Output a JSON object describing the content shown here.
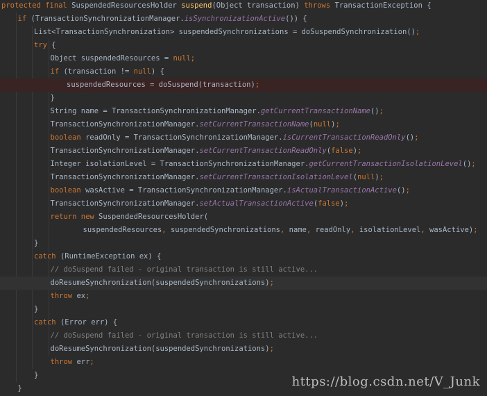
{
  "editor": {
    "theme_colors": {
      "background": "#2b2b2b",
      "keyword": "#cc7832",
      "method_declaration": "#ffc66d",
      "static_call": "#9876aa",
      "comment": "#808080",
      "default_text": "#a9b7c6",
      "breakpoint_line": "#3a2323",
      "caret_line": "#323232"
    },
    "lines": [
      {
        "indent": 0,
        "hl": "",
        "tokens": [
          {
            "t": "kw",
            "s": "protected final "
          },
          {
            "t": "df",
            "s": "SuspendedResourcesHolder "
          },
          {
            "t": "fn",
            "s": "suspend"
          },
          {
            "t": "df",
            "s": "(Object transaction) "
          },
          {
            "t": "kw",
            "s": "throws "
          },
          {
            "t": "df",
            "s": "TransactionException {"
          }
        ]
      },
      {
        "indent": 1,
        "hl": "",
        "tokens": [
          {
            "t": "kw",
            "s": "if "
          },
          {
            "t": "df",
            "s": "(TransactionSynchronizationManager."
          },
          {
            "t": "st",
            "s": "isSynchronizationActive"
          },
          {
            "t": "df",
            "s": "()) {"
          }
        ]
      },
      {
        "indent": 2,
        "hl": "",
        "tokens": [
          {
            "t": "df",
            "s": "List<TransactionSynchronization> suspendedSynchronizations = doSuspendSynchronization()"
          },
          {
            "t": "kw",
            "s": ";"
          }
        ]
      },
      {
        "indent": 2,
        "hl": "",
        "tokens": [
          {
            "t": "kw",
            "s": "try "
          },
          {
            "t": "df",
            "s": "{"
          }
        ]
      },
      {
        "indent": 3,
        "hl": "",
        "tokens": [
          {
            "t": "df",
            "s": "Object suspendedResources = "
          },
          {
            "t": "kw",
            "s": "null;"
          }
        ]
      },
      {
        "indent": 3,
        "hl": "",
        "tokens": [
          {
            "t": "kw",
            "s": "if "
          },
          {
            "t": "df",
            "s": "(transaction != "
          },
          {
            "t": "kw",
            "s": "null"
          },
          {
            "t": "df",
            "s": ") {"
          }
        ]
      },
      {
        "indent": 4,
        "hl": "breakpoint",
        "tokens": [
          {
            "t": "df",
            "s": "suspendedResources = doSuspend(transaction)"
          },
          {
            "t": "kw",
            "s": ";"
          }
        ]
      },
      {
        "indent": 3,
        "hl": "",
        "tokens": [
          {
            "t": "df",
            "s": "}"
          }
        ]
      },
      {
        "indent": 3,
        "hl": "",
        "tokens": [
          {
            "t": "df",
            "s": "String name = TransactionSynchronizationManager."
          },
          {
            "t": "st",
            "s": "getCurrentTransactionName"
          },
          {
            "t": "df",
            "s": "()"
          },
          {
            "t": "kw",
            "s": ";"
          }
        ]
      },
      {
        "indent": 3,
        "hl": "",
        "tokens": [
          {
            "t": "df",
            "s": "TransactionSynchronizationManager."
          },
          {
            "t": "st",
            "s": "setCurrentTransactionName"
          },
          {
            "t": "df",
            "s": "("
          },
          {
            "t": "kw",
            "s": "null"
          },
          {
            "t": "df",
            "s": ")"
          },
          {
            "t": "kw",
            "s": ";"
          }
        ]
      },
      {
        "indent": 3,
        "hl": "",
        "tokens": [
          {
            "t": "kw",
            "s": "boolean "
          },
          {
            "t": "df",
            "s": "readOnly = TransactionSynchronizationManager."
          },
          {
            "t": "st",
            "s": "isCurrentTransactionReadOnly"
          },
          {
            "t": "df",
            "s": "()"
          },
          {
            "t": "kw",
            "s": ";"
          }
        ]
      },
      {
        "indent": 3,
        "hl": "",
        "tokens": [
          {
            "t": "df",
            "s": "TransactionSynchronizationManager."
          },
          {
            "t": "st",
            "s": "setCurrentTransactionReadOnly"
          },
          {
            "t": "df",
            "s": "("
          },
          {
            "t": "kw",
            "s": "false"
          },
          {
            "t": "df",
            "s": ")"
          },
          {
            "t": "kw",
            "s": ";"
          }
        ]
      },
      {
        "indent": 3,
        "hl": "",
        "tokens": [
          {
            "t": "df",
            "s": "Integer isolationLevel = TransactionSynchronizationManager."
          },
          {
            "t": "st",
            "s": "getCurrentTransactionIsolationLevel"
          },
          {
            "t": "df",
            "s": "()"
          },
          {
            "t": "kw",
            "s": ";"
          }
        ]
      },
      {
        "indent": 3,
        "hl": "",
        "tokens": [
          {
            "t": "df",
            "s": "TransactionSynchronizationManager."
          },
          {
            "t": "st",
            "s": "setCurrentTransactionIsolationLevel"
          },
          {
            "t": "df",
            "s": "("
          },
          {
            "t": "kw",
            "s": "null"
          },
          {
            "t": "df",
            "s": ")"
          },
          {
            "t": "kw",
            "s": ";"
          }
        ]
      },
      {
        "indent": 3,
        "hl": "",
        "tokens": [
          {
            "t": "kw",
            "s": "boolean "
          },
          {
            "t": "df",
            "s": "wasActive = TransactionSynchronizationManager."
          },
          {
            "t": "st",
            "s": "isActualTransactionActive"
          },
          {
            "t": "df",
            "s": "()"
          },
          {
            "t": "kw",
            "s": ";"
          }
        ]
      },
      {
        "indent": 3,
        "hl": "",
        "tokens": [
          {
            "t": "df",
            "s": "TransactionSynchronizationManager."
          },
          {
            "t": "st",
            "s": "setActualTransactionActive"
          },
          {
            "t": "df",
            "s": "("
          },
          {
            "t": "kw",
            "s": "false"
          },
          {
            "t": "df",
            "s": ")"
          },
          {
            "t": "kw",
            "s": ";"
          }
        ]
      },
      {
        "indent": 3,
        "hl": "",
        "tokens": [
          {
            "t": "kw",
            "s": "return new "
          },
          {
            "t": "df",
            "s": "SuspendedResourcesHolder("
          }
        ]
      },
      {
        "indent": 5,
        "hl": "",
        "tokens": [
          {
            "t": "df",
            "s": "suspendedResources"
          },
          {
            "t": "kw",
            "s": ", "
          },
          {
            "t": "df",
            "s": "suspendedSynchronizations"
          },
          {
            "t": "kw",
            "s": ", "
          },
          {
            "t": "df",
            "s": "name"
          },
          {
            "t": "kw",
            "s": ", "
          },
          {
            "t": "df",
            "s": "readOnly"
          },
          {
            "t": "kw",
            "s": ", "
          },
          {
            "t": "df",
            "s": "isolationLevel"
          },
          {
            "t": "kw",
            "s": ", "
          },
          {
            "t": "df",
            "s": "wasActive)"
          },
          {
            "t": "kw",
            "s": ";"
          }
        ]
      },
      {
        "indent": 2,
        "hl": "",
        "tokens": [
          {
            "t": "df",
            "s": "}"
          }
        ]
      },
      {
        "indent": 2,
        "hl": "",
        "tokens": [
          {
            "t": "kw",
            "s": "catch "
          },
          {
            "t": "df",
            "s": "(RuntimeException ex) {"
          }
        ]
      },
      {
        "indent": 3,
        "hl": "",
        "tokens": [
          {
            "t": "cm",
            "s": "// doSuspend failed - original transaction is still active..."
          }
        ]
      },
      {
        "indent": 3,
        "hl": "caret",
        "tokens": [
          {
            "t": "df",
            "s": "doResumeSynchronization(suspendedSynchronizations)"
          },
          {
            "t": "kw",
            "s": ";"
          }
        ]
      },
      {
        "indent": 3,
        "hl": "",
        "tokens": [
          {
            "t": "kw",
            "s": "throw "
          },
          {
            "t": "df",
            "s": "ex"
          },
          {
            "t": "kw",
            "s": ";"
          }
        ]
      },
      {
        "indent": 2,
        "hl": "",
        "tokens": [
          {
            "t": "df",
            "s": "}"
          }
        ]
      },
      {
        "indent": 2,
        "hl": "",
        "tokens": [
          {
            "t": "kw",
            "s": "catch "
          },
          {
            "t": "df",
            "s": "(Error err) {"
          }
        ]
      },
      {
        "indent": 3,
        "hl": "",
        "tokens": [
          {
            "t": "cm",
            "s": "// doSuspend failed - original transaction is still active..."
          }
        ]
      },
      {
        "indent": 3,
        "hl": "",
        "tokens": [
          {
            "t": "df",
            "s": "doResumeSynchronization(suspendedSynchronizations)"
          },
          {
            "t": "kw",
            "s": ";"
          }
        ]
      },
      {
        "indent": 3,
        "hl": "",
        "tokens": [
          {
            "t": "kw",
            "s": "throw "
          },
          {
            "t": "df",
            "s": "err"
          },
          {
            "t": "kw",
            "s": ";"
          }
        ]
      },
      {
        "indent": 2,
        "hl": "",
        "tokens": [
          {
            "t": "df",
            "s": "}"
          }
        ]
      },
      {
        "indent": 1,
        "hl": "",
        "tokens": [
          {
            "t": "df",
            "s": "}"
          }
        ]
      }
    ]
  },
  "watermark": "https://blog.csdn.net/V_Junk"
}
